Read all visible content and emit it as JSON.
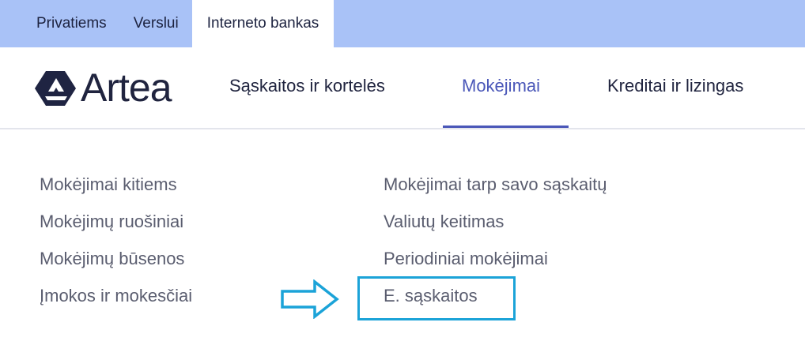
{
  "top_tabs": [
    {
      "label": "Privatiems"
    },
    {
      "label": "Verslui"
    },
    {
      "label": "Interneto bankas"
    }
  ],
  "logo": {
    "text": "Artea"
  },
  "main_nav": [
    {
      "label": "Sąskaitos ir kortelės"
    },
    {
      "label": "Mokėjimai"
    },
    {
      "label": "Kreditai ir lizingas"
    }
  ],
  "menu": {
    "left": [
      {
        "label": "Mokėjimai kitiems"
      },
      {
        "label": "Mokėjimų ruošiniai"
      },
      {
        "label": "Mokėjimų būsenos"
      },
      {
        "label": "Įmokos ir mokesčiai"
      }
    ],
    "right": [
      {
        "label": "Mokėjimai tarp savo sąskaitų"
      },
      {
        "label": "Valiutų keitimas"
      },
      {
        "label": "Periodiniai mokėjimai"
      },
      {
        "label": "E. sąskaitos"
      }
    ]
  },
  "colors": {
    "top_bar": "#a9c2f7",
    "active_nav": "#4a57b8",
    "highlight": "#1ba3d8"
  }
}
